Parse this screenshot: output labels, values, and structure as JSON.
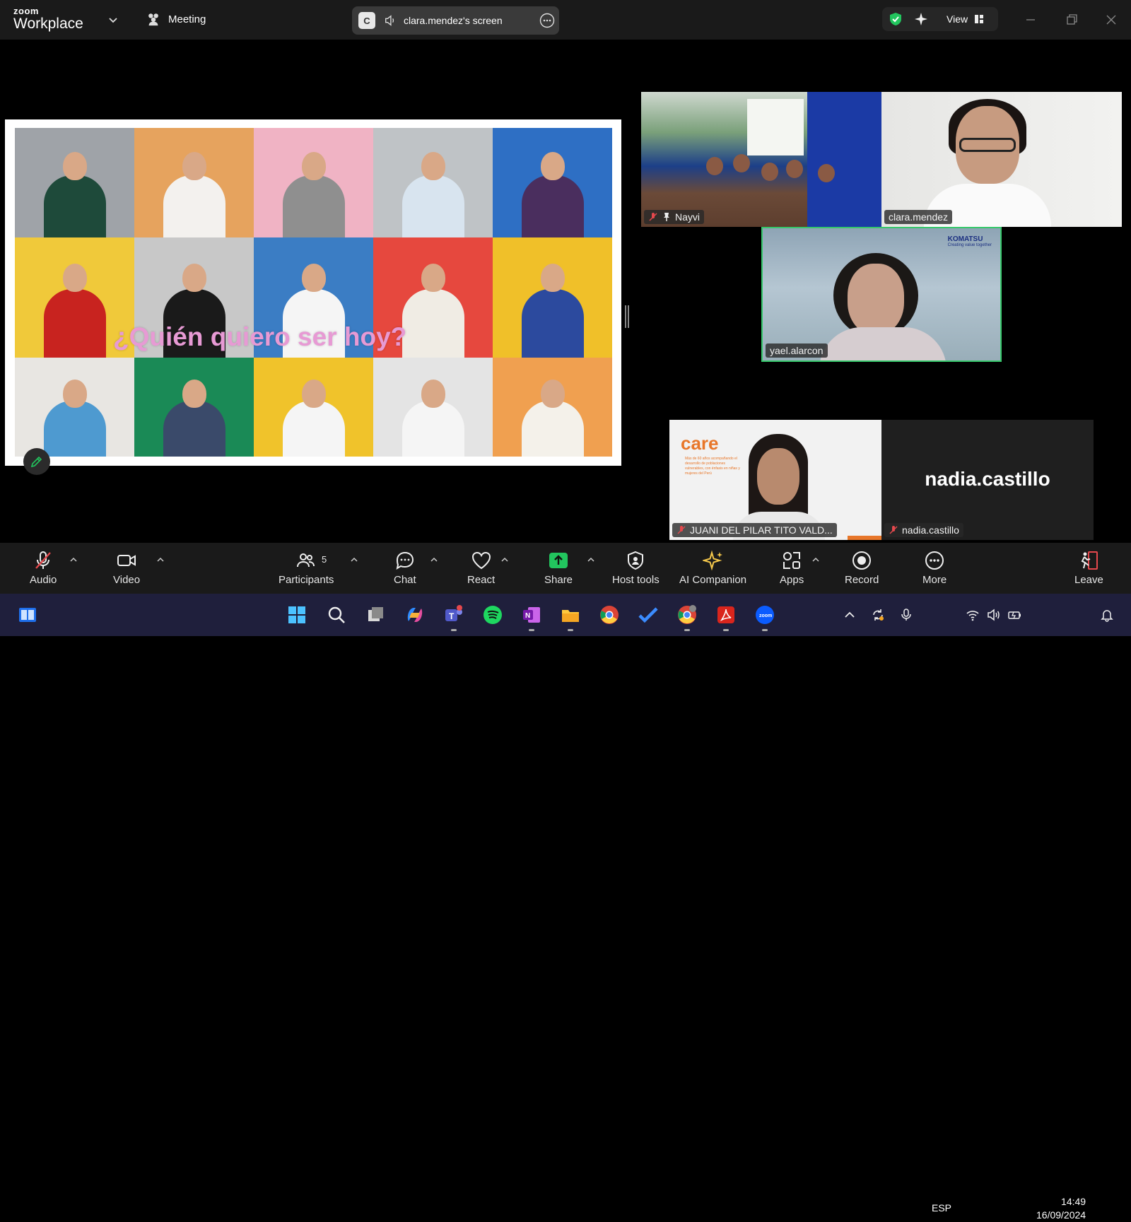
{
  "titlebar": {
    "brand_small": "zoom",
    "brand_big": "Workplace",
    "meeting_label": "Meeting",
    "screen_initial": "C",
    "screen_label": "clara.mendez's screen",
    "view_label": "View"
  },
  "slide": {
    "title": "¿Quién quiero ser hoy?"
  },
  "participants": {
    "tiles": [
      {
        "name": "Nayvi",
        "muted": true,
        "pinned": true
      },
      {
        "name": "clara.mendez",
        "muted": false
      },
      {
        "name": "yael.alarcon",
        "muted": false,
        "active_speaker": true
      },
      {
        "name": "JUANI DEL PILAR TITO VALD...",
        "muted": true
      },
      {
        "name": "nadia.castillo",
        "muted": true,
        "display_name": "nadia.castillo"
      }
    ],
    "yael_logo": "KOMATSU",
    "yael_logo_tag": "Creating value together",
    "juani_logo": "care",
    "juani_text": "Más de 60 años acompañando el desarrollo de poblaciones vulnerables, con énfasis en niñas y mujeres del Perú"
  },
  "toolbar": {
    "audio": "Audio",
    "video": "Video",
    "participants": "Participants",
    "participants_count": "5",
    "chat": "Chat",
    "react": "React",
    "share": "Share",
    "host_tools": "Host tools",
    "ai_companion": "AI Companion",
    "apps": "Apps",
    "record": "Record",
    "more": "More",
    "leave": "Leave"
  },
  "taskbar": {
    "lang": "ESP",
    "time": "14:49",
    "date": "16/09/2024"
  },
  "colors": {
    "accent_green": "#35c76a",
    "share_green": "#22c55e",
    "muted_red": "#e5484d",
    "slide_title_pink": "#e79ad4",
    "care_orange": "#e8772a"
  },
  "collage_tiles": [
    {
      "bg": "#9fa3a8",
      "body": "#1e4a3a"
    },
    {
      "bg": "#e6a35e",
      "body": "#f3f1ee"
    },
    {
      "bg": "#f0b3c4",
      "body": "#8f8f8f"
    },
    {
      "bg": "#bfc3c6",
      "body": "#d8e4ef"
    },
    {
      "bg": "#2e6fc4",
      "body": "#4a2e5e"
    },
    {
      "bg": "#f0c93a",
      "body": "#c8231f"
    },
    {
      "bg": "#c8c8c8",
      "body": "#1a1a1a"
    },
    {
      "bg": "#3b7dc4",
      "body": "#f5f5f5"
    },
    {
      "bg": "#e6483e",
      "body": "#f0ece4"
    },
    {
      "bg": "#f0c029",
      "body": "#2c4a9e"
    },
    {
      "bg": "#e8e6e2",
      "body": "#4e9ad0"
    },
    {
      "bg": "#1a8a56",
      "body": "#3a4a6a"
    },
    {
      "bg": "#f0c32b",
      "body": "#f5f5f5"
    },
    {
      "bg": "#e4e4e4",
      "body": "#f5f5f5"
    },
    {
      "bg": "#f0a050",
      "body": "#f4f1ea"
    }
  ]
}
